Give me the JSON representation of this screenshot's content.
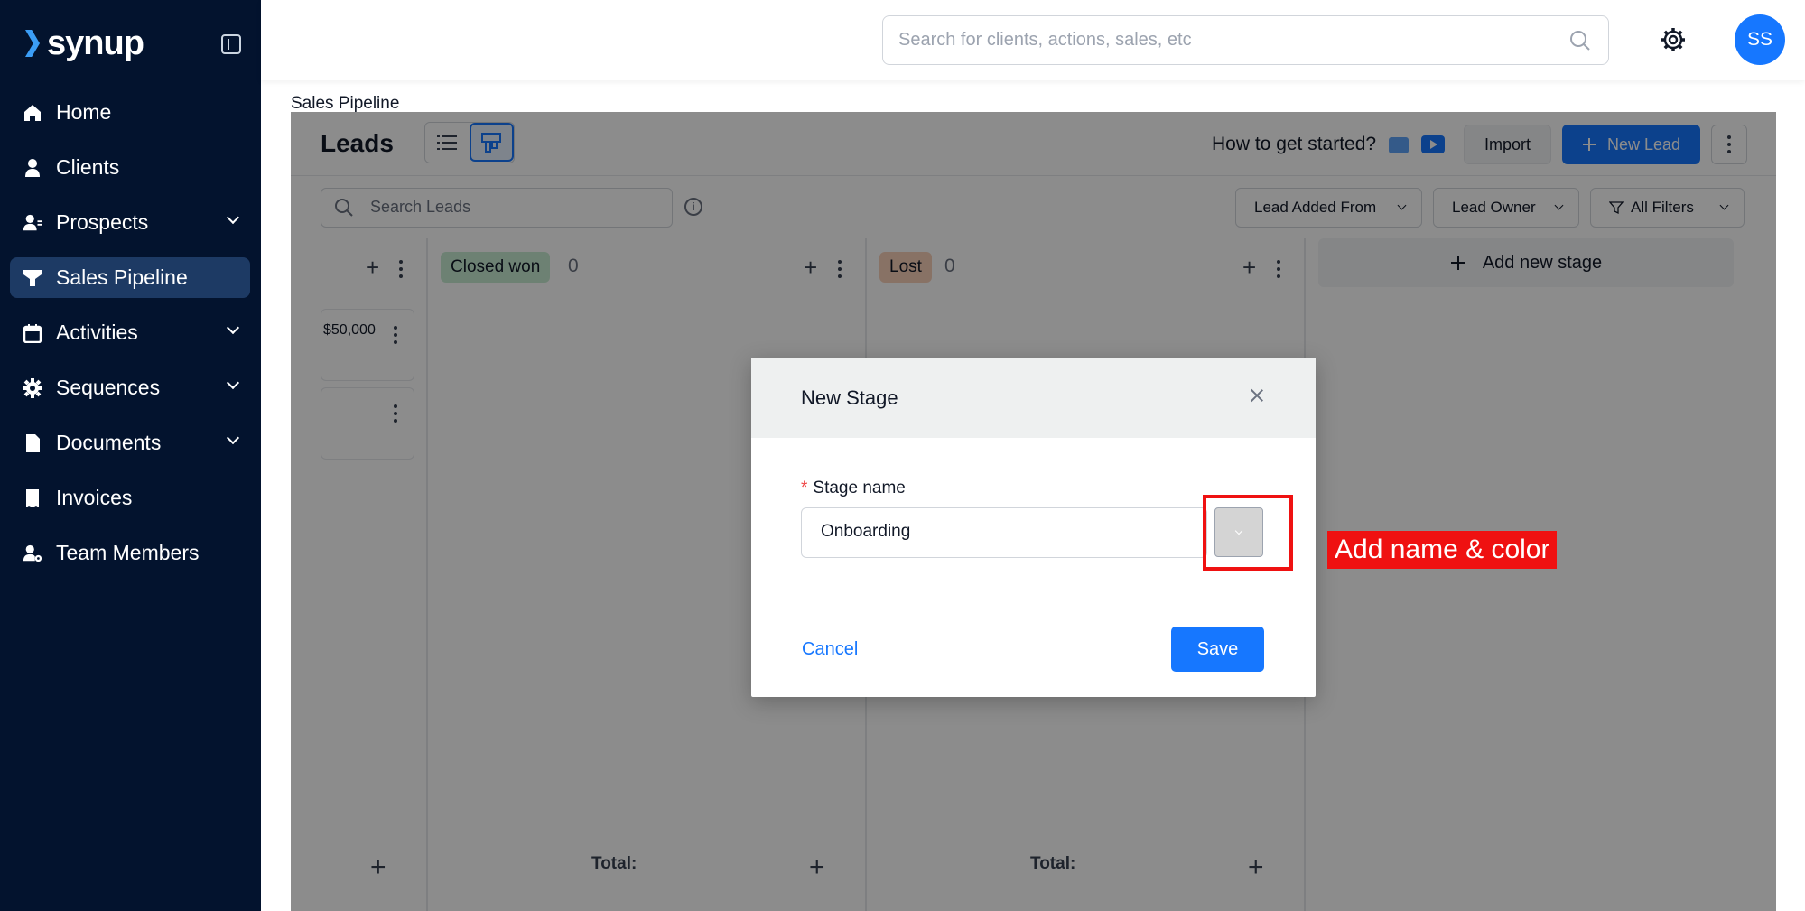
{
  "brand": {
    "name": "synup"
  },
  "sidebar": {
    "items": [
      {
        "label": "Home",
        "icon": "home-icon",
        "has_chevron": false,
        "active": false
      },
      {
        "label": "Clients",
        "icon": "user-icon",
        "has_chevron": false,
        "active": false
      },
      {
        "label": "Prospects",
        "icon": "users-icon",
        "has_chevron": true,
        "active": false
      },
      {
        "label": "Sales Pipeline",
        "icon": "funnel-icon",
        "has_chevron": false,
        "active": true
      },
      {
        "label": "Activities",
        "icon": "calendar-icon",
        "has_chevron": true,
        "active": false
      },
      {
        "label": "Sequences",
        "icon": "cog-icon",
        "has_chevron": true,
        "active": false
      },
      {
        "label": "Documents",
        "icon": "document-icon",
        "has_chevron": true,
        "active": false
      },
      {
        "label": "Invoices",
        "icon": "invoice-icon",
        "has_chevron": false,
        "active": false
      },
      {
        "label": "Team Members",
        "icon": "team-icon",
        "has_chevron": false,
        "active": false
      }
    ]
  },
  "topbar": {
    "search_placeholder": "Search for clients, actions, sales, etc",
    "avatar_initials": "SS"
  },
  "page": {
    "label": "Sales Pipeline"
  },
  "leads": {
    "title": "Leads",
    "how_to": "How to get started?",
    "import_label": "Import",
    "new_lead_label": "New Lead",
    "search_placeholder": "Search Leads",
    "filters": [
      "Lead Added From",
      "Lead Owner",
      "All Filters"
    ]
  },
  "columns": [
    {
      "name": "Closed won",
      "count": "0",
      "tag_color": "#c7ecd1",
      "total_label": "Total:"
    },
    {
      "name": "Lost",
      "count": "0",
      "tag_color": "#f8cfb9",
      "total_label": "Total:"
    }
  ],
  "partial_column": {
    "card_amount": "$50,000"
  },
  "add_stage_label": "Add new stage",
  "modal": {
    "title": "New Stage",
    "field_required_mark": "*",
    "field_label": "Stage name",
    "field_value": "Onboarding",
    "cancel_label": "Cancel",
    "save_label": "Save"
  },
  "annotation": {
    "text": "Add name & color"
  },
  "colors": {
    "sidebar_bg": "#03132e",
    "sidebar_active": "#1d3a64",
    "primary": "#1677ff",
    "highlight": "#ef1111"
  }
}
